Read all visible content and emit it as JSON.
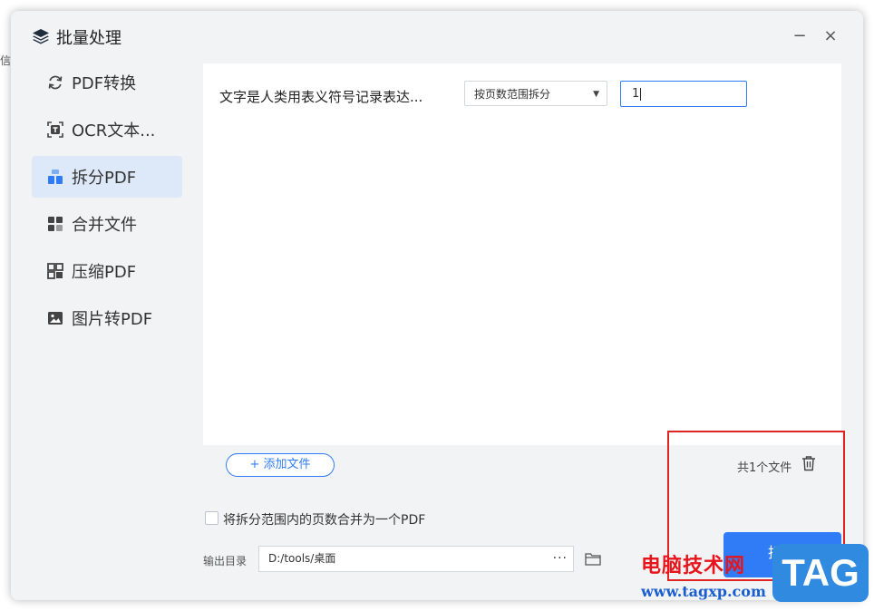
{
  "edge_text": "信",
  "window": {
    "title": "批量处理",
    "minimize": "−",
    "close": "×"
  },
  "sidebar": {
    "items": [
      {
        "label": "PDF转换",
        "icon": "refresh-icon"
      },
      {
        "label": "OCR文本...",
        "icon": "ocr-text-icon"
      },
      {
        "label": "拆分PDF",
        "icon": "split-icon",
        "active": true
      },
      {
        "label": "合并文件",
        "icon": "merge-icon"
      },
      {
        "label": "压缩PDF",
        "icon": "compress-icon"
      },
      {
        "label": "图片转PDF",
        "icon": "image-icon"
      }
    ]
  },
  "file_row": {
    "name": "文字是人类用表义符号记录表达...",
    "mode_selected": "按页数范围拆分",
    "range_value": "1"
  },
  "list_footer": {
    "add_label": "+ 添加文件",
    "count": "共1个文件"
  },
  "options": {
    "merge_label": "将拆分范围内的页数合并为一个PDF",
    "merge_checked": false
  },
  "output": {
    "label": "输出目录",
    "path": "D:/tools/桌面",
    "more": "···"
  },
  "action": {
    "split_label": "拆分"
  },
  "watermark": {
    "text": "电脑技术网",
    "url": "www.tagxp.com",
    "tag": "TAG"
  },
  "colors": {
    "accent": "#2f7cf6",
    "highlight_box": "#e02424",
    "sidebar_active": "#dde8f8"
  }
}
